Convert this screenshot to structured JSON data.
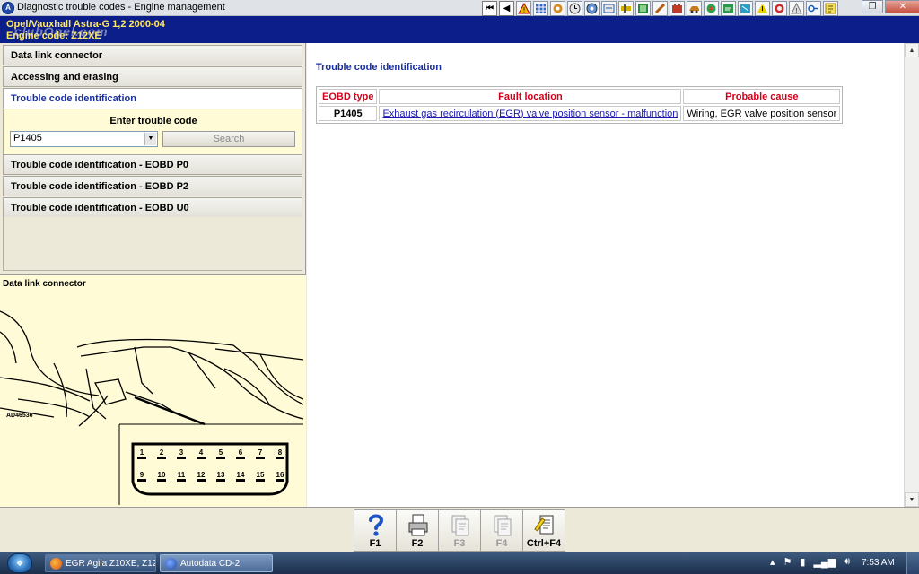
{
  "window": {
    "title": "Diagnostic trouble codes - Engine management",
    "app_icon": "autodata-icon"
  },
  "toolbar": {
    "icons": [
      "first-page-icon",
      "previous-page-icon",
      "warning-icon",
      "grid-icon",
      "gear-icon",
      "clock-icon",
      "diagnostics-icon",
      "electrical-icon",
      "crankshaft-icon",
      "ecu-icon",
      "tools-icon",
      "battery-icon",
      "car-icon",
      "brake-icon",
      "service-icon",
      "ac-icon",
      "windscreen-icon",
      "airbag-icon",
      "alert-icon",
      "key-icon",
      "info-icon"
    ]
  },
  "header": {
    "vehicle": "Opel/Vauxhall   Astra-G  1,2  2000-04",
    "engine": "Engine code: Z12XE",
    "watermark": "clubOpel.com"
  },
  "menu": {
    "items": [
      "Data link connector",
      "Accessing and erasing",
      "Trouble code identification"
    ],
    "entry_label": "Enter trouble code",
    "code_value": "P1405",
    "search_label": "Search",
    "sub_items": [
      "Trouble code identification - EOBD P0",
      "Trouble code identification - EOBD P2",
      "Trouble code identification - EOBD U0"
    ]
  },
  "connector": {
    "title": "Data link connector",
    "diagram_ref": "AD46536",
    "pins_top": [
      "1",
      "2",
      "3",
      "4",
      "5",
      "6",
      "7",
      "8"
    ],
    "pins_bottom": [
      "9",
      "10",
      "11",
      "12",
      "13",
      "14",
      "15",
      "16"
    ]
  },
  "content": {
    "title": "Trouble code identification",
    "table": {
      "headers": [
        "EOBD type",
        "Fault location",
        "Probable cause"
      ],
      "rows": [
        {
          "code": "P1405",
          "fault": "Exhaust gas recirculation (EGR) valve position sensor - malfunction",
          "cause": "Wiring, EGR valve position sensor"
        }
      ]
    }
  },
  "function_keys": [
    {
      "label": "F1",
      "icon": "help-icon",
      "enabled": true
    },
    {
      "label": "F2",
      "icon": "print-icon",
      "enabled": true
    },
    {
      "label": "F3",
      "icon": "document-icon",
      "enabled": false
    },
    {
      "label": "F4",
      "icon": "document-icon",
      "enabled": false
    },
    {
      "label": "Ctrl+F4",
      "icon": "edit-document-icon",
      "enabled": true
    }
  ],
  "taskbar": {
    "tasks": [
      {
        "label": "EGR Agila Z10XE, Z12...",
        "icon": "firefox-icon"
      },
      {
        "label": "Autodata CD-2",
        "icon": "autodata-icon"
      }
    ],
    "clock": "7:53 AM"
  },
  "colors": {
    "header_bg": "#0b1e8a",
    "header_text": "#ffe86a",
    "accent_blue": "#1a2fa0",
    "table_header_red": "#d4001a",
    "panel_yellow": "#fffbd6"
  }
}
